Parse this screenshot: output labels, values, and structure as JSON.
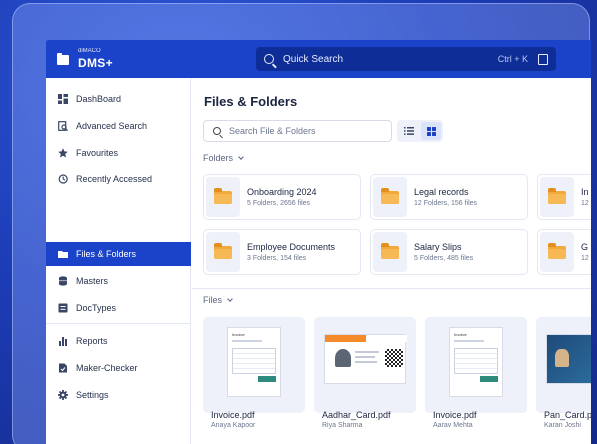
{
  "app": {
    "brand_sub": "diMACO",
    "brand_main": "DMS+"
  },
  "search": {
    "placeholder": "Quick Search",
    "shortcut": "Ctrl + K"
  },
  "sidebar": {
    "items": [
      {
        "label": "DashBoard",
        "icon": "dashboard-icon"
      },
      {
        "label": "Advanced Search",
        "icon": "advanced-search-icon"
      },
      {
        "label": "Favourites",
        "icon": "star-icon"
      },
      {
        "label": "Recently Accessed",
        "icon": "history-icon"
      },
      {
        "label": "Files & Folders",
        "icon": "folder-icon",
        "active": true
      },
      {
        "label": "Masters",
        "icon": "database-icon"
      },
      {
        "label": "DocTypes",
        "icon": "doctype-icon"
      },
      {
        "label": "Reports",
        "icon": "bar-chart-icon"
      },
      {
        "label": "Maker-Checker",
        "icon": "checklist-icon"
      },
      {
        "label": "Settings",
        "icon": "gear-icon"
      }
    ]
  },
  "main": {
    "title": "Files & Folders",
    "search_placeholder": "Search File & Folders",
    "folders_label": "Folders",
    "files_label": "Files",
    "folders": [
      {
        "name": "Onboarding 2024",
        "meta": "5 Folders, 2656 files"
      },
      {
        "name": "Legal records",
        "meta": "12 Folders, 156 files"
      },
      {
        "name": "In",
        "meta": "12"
      },
      {
        "name": "Employee Documents",
        "meta": "3 Folders, 154 files"
      },
      {
        "name": "Salary Slips",
        "meta": "5 Folders, 485 files"
      },
      {
        "name": "G",
        "meta": "12"
      }
    ],
    "files": [
      {
        "name": "Invoice.pdf",
        "owner": "Anaya Kapoor"
      },
      {
        "name": "Aadhar_Card.pdf",
        "owner": "Riya Sharma"
      },
      {
        "name": "Invoice.pdf",
        "owner": "Aarav Mehta"
      },
      {
        "name": "Pan_Card.p",
        "owner": "Karan Joshi"
      }
    ],
    "thumb_header": "Invoice"
  },
  "colors": {
    "brand": "#1a43c9",
    "folder": "#f2a93b",
    "background": "#1d3db8"
  }
}
